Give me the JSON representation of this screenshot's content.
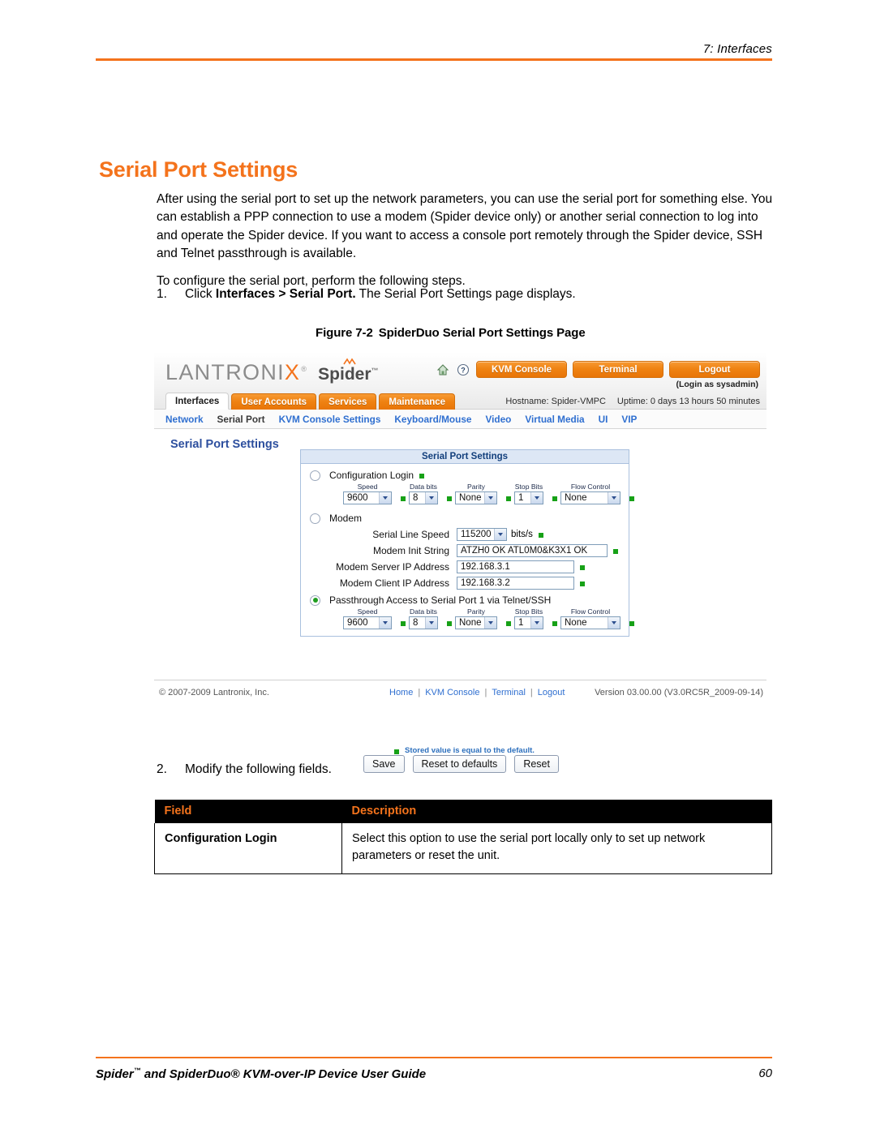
{
  "page_header": {
    "running_head": "7: Interfaces"
  },
  "title": "Serial Port Settings",
  "paragraphs": {
    "intro": "After using the serial port to set up the network parameters, you can use the serial port for something else. You can establish a PPP connection to use a modem (Spider device only) or another serial connection to log into and operate the Spider device. If you want to access a console port remotely through the Spider device, SSH and Telnet passthrough is available.",
    "lead_in": "To configure the serial port, perform the following steps."
  },
  "steps": [
    {
      "number": "1.",
      "prefix": "Click ",
      "bold": "Interfaces > Serial Port.",
      "suffix": " The Serial Port Settings page displays."
    },
    {
      "number": "2.",
      "text": "Modify the following fields."
    }
  ],
  "figure": {
    "caption_number": "Figure 7-2",
    "caption_text": "SpiderDuo Serial Port Settings Page",
    "brand": {
      "company_part1": "LANTRONI",
      "company_accent": "X",
      "registered": "®",
      "product": "Spider",
      "trademark": "™"
    },
    "toolbar": {
      "home_icon": "home-icon",
      "help_icon": "help-icon",
      "buttons": [
        "KVM Console",
        "Terminal",
        "Logout"
      ],
      "login_as": "(Login as sysadmin)"
    },
    "tabs": [
      {
        "label": "Interfaces",
        "active": true
      },
      {
        "label": "User Accounts",
        "active": false
      },
      {
        "label": "Services",
        "active": false
      },
      {
        "label": "Maintenance",
        "active": false
      }
    ],
    "status": {
      "hostname": "Hostname: Spider-VMPC",
      "uptime": "Uptime: 0 days 13 hours 50 minutes"
    },
    "subnav": [
      {
        "label": "Network",
        "current": false
      },
      {
        "label": "Serial Port",
        "current": true
      },
      {
        "label": "KVM Console Settings",
        "current": false
      },
      {
        "label": "Keyboard/Mouse",
        "current": false
      },
      {
        "label": "Video",
        "current": false
      },
      {
        "label": "Virtual Media",
        "current": false
      },
      {
        "label": "UI",
        "current": false
      },
      {
        "label": "VIP",
        "current": false
      }
    ],
    "page_heading": "Serial Port Settings",
    "panel_title": "Serial Port Settings",
    "options": {
      "configuration_login": {
        "label": "Configuration Login",
        "selected": false,
        "serial": {
          "speed_caption": "Speed",
          "speed_value": "9600",
          "data_caption": "Data bits",
          "data_value": "8",
          "parity_caption": "Parity",
          "parity_value": "None",
          "stop_caption": "Stop Bits",
          "stop_value": "1",
          "flow_caption": "Flow Control",
          "flow_value": "None"
        }
      },
      "modem": {
        "label": "Modem",
        "selected": false,
        "fields": [
          {
            "label": "Serial Line Speed",
            "value": "115200",
            "unit": "bits/s",
            "kind": "select"
          },
          {
            "label": "Modem Init String",
            "value": "ATZH0 OK ATL0M0&K3X1 OK",
            "kind": "text-wide"
          },
          {
            "label": "Modem Server IP Address",
            "value": "192.168.3.1",
            "kind": "text-ip"
          },
          {
            "label": "Modem Client IP Address",
            "value": "192.168.3.2",
            "kind": "text-ip"
          }
        ]
      },
      "passthrough": {
        "label": "Passthrough Access to Serial Port 1 via Telnet/SSH",
        "selected": true,
        "serial": {
          "speed_caption": "Speed",
          "speed_value": "9600",
          "data_caption": "Data bits",
          "data_value": "8",
          "parity_caption": "Parity",
          "parity_value": "None",
          "stop_caption": "Stop Bits",
          "stop_value": "1",
          "flow_caption": "Flow Control",
          "flow_value": "None"
        }
      }
    },
    "legend": "Stored value is equal to the default.",
    "buttons": {
      "save": "Save",
      "reset_defaults": "Reset to defaults",
      "reset": "Reset"
    },
    "footer": {
      "copyright": "© 2007-2009 Lantronix, Inc.",
      "links": [
        "Home",
        "KVM Console",
        "Terminal",
        "Logout"
      ],
      "version": "Version 03.00.00 (V3.0RC5R_2009-09-14)"
    }
  },
  "field_table": {
    "headers": [
      "Field",
      "Description"
    ],
    "rows": [
      {
        "field": "Configuration Login",
        "description": "Select this option to use the serial port locally only to set up network parameters or reset the unit."
      }
    ]
  },
  "page_footer": {
    "guide_title_1": "Spider",
    "guide_tm": "™",
    "guide_title_2": " and SpiderDuo",
    "guide_reg": "®",
    "guide_title_3": " KVM-over-IP Device User Guide",
    "page_number": "60"
  },
  "colors": {
    "accent_orange": "#F4731C",
    "link_blue": "#2f6fd0",
    "heading_blue": "#2d4f9e",
    "default_marker_green": "#17A117"
  }
}
